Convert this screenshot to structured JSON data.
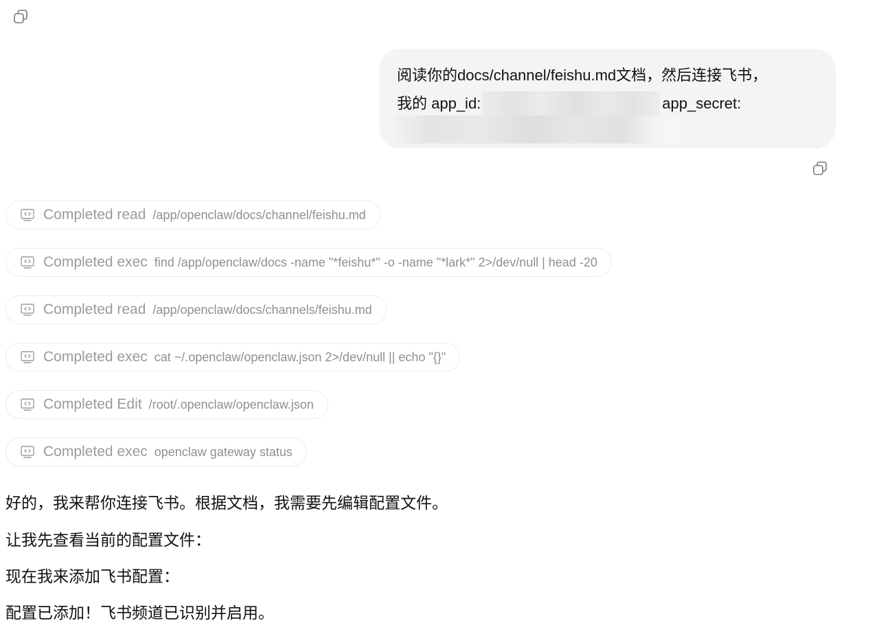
{
  "icons": {
    "copy_top": "copy-icon",
    "copy_message": "copy-icon",
    "tool": "code-terminal-icon"
  },
  "user_message": {
    "line1": "阅读你的docs/channel/feishu.md文档，然后连接飞书，",
    "line2_prefix": "我的 app_id:",
    "line2_suffix": "app_secret:"
  },
  "tool_calls": [
    {
      "status": "Completed read",
      "detail": "/app/openclaw/docs/channel/feishu.md"
    },
    {
      "status": "Completed exec",
      "detail": "find /app/openclaw/docs -name \"*feishu*\" -o -name \"*lark*\" 2>/dev/null | head -20"
    },
    {
      "status": "Completed read",
      "detail": "/app/openclaw/docs/channels/feishu.md"
    },
    {
      "status": "Completed exec",
      "detail": "cat ~/.openclaw/openclaw.json 2>/dev/null || echo \"{}\""
    },
    {
      "status": "Completed Edit",
      "detail": "/root/.openclaw/openclaw.json"
    },
    {
      "status": "Completed exec",
      "detail": "openclaw gateway status"
    }
  ],
  "assistant_reply": [
    "好的，我来帮你连接飞书。根据文档，我需要先编辑配置文件。",
    "让我先查看当前的配置文件：",
    "现在我来添加飞书配置：",
    "配置已添加！飞书频道已识别并启用。"
  ],
  "colors": {
    "bubble_bg": "#f4f4f4",
    "chip_border": "#ececec",
    "muted_text": "#9a9a9a",
    "body_text": "#111111"
  }
}
